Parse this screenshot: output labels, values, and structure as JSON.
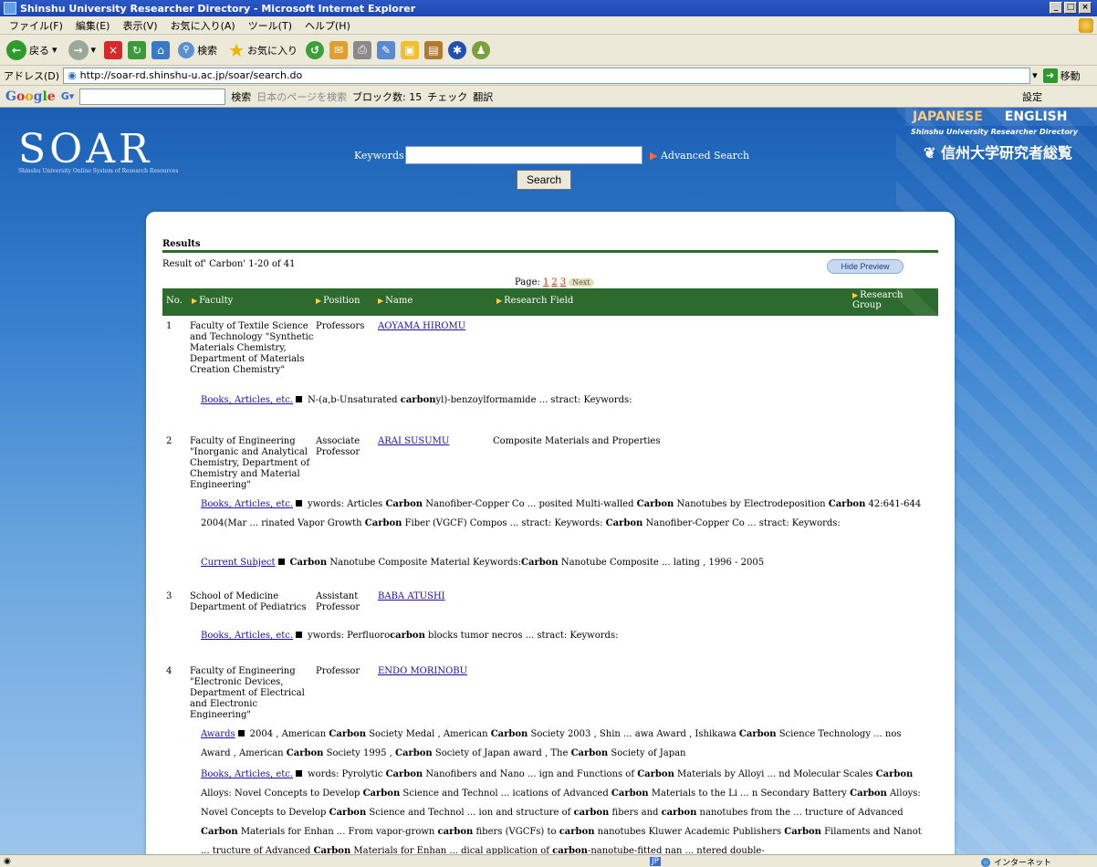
{
  "window": {
    "title": "Shinshu University Researcher Directory - Microsoft Internet Explorer",
    "controls": [
      "_",
      "□",
      "×"
    ]
  },
  "menu": [
    "ファイル(F)",
    "編集(E)",
    "表示(V)",
    "お気に入り(A)",
    "ツール(T)",
    "ヘルプ(H)"
  ],
  "toolbar": {
    "back": "戻る",
    "search": "検索",
    "favorites": "お気に入り"
  },
  "address": {
    "label": "アドレス(D)",
    "url": "http://soar-rd.shinshu-u.ac.jp/soar/search.do",
    "go": "移動"
  },
  "googlebar": {
    "logo": "Google",
    "search_btn": "検索",
    "page_search": "日本のページを検索",
    "blocked": "ブロック数: 15",
    "check": "チェック",
    "translate": "翻訳",
    "settings": "設定"
  },
  "site": {
    "logo": "SOAR",
    "logo_sub": "Shinshu University Online System of Research Resources",
    "keywords_label": "Keywords",
    "advanced": "Advanced Search",
    "search_btn": "Search",
    "lang_jp": "JAPANESE",
    "lang_en": "ENGLISH",
    "directory_en": "Shinshu University Researcher Directory",
    "directory_jp": "信州大学研究者総覧"
  },
  "results": {
    "heading": "Results",
    "summary": "Result of' Carbon'  1-20 of 41",
    "hide_preview": "Hide Preview",
    "page_label": "Page:",
    "pages": [
      "1",
      "2",
      "3"
    ],
    "next": "Next",
    "columns": [
      "No.",
      "Faculty",
      "Position",
      "Name",
      "Research Field",
      "Research Group"
    ]
  },
  "rows": [
    {
      "no": "1",
      "faculty": "Faculty of Textile Science and Technology \"Synthetic Materials Chemistry, Department of Materials Creation Chemistry\"",
      "position": "Professors",
      "name": "AOYAMA  HIROMU",
      "field": "",
      "snippets": [
        {
          "label": "Books, Articles, etc.",
          "text": "N-(a,b-Unsaturated carbonyl)-benzoylformamide ... stract:  Keywords:"
        }
      ]
    },
    {
      "no": "2",
      "faculty": "Faculty of Engineering \"Inorganic and Analytical Chemistry, Department of Chemistry and Material Engineering\"",
      "position": "Associate Professor",
      "name": "ARAI  SUSUMU",
      "field": "Composite Materials and Properties",
      "snippets": [
        {
          "label": "Books, Articles, etc.",
          "text": "ywords:      Articles   Carbon Nanofiber-Copper Co ... posited Multi-walled Carbon Nanotubes by Electrodeposition Carbon 42:641-644 2004(Mar ... rinated Vapor Growth Carbon Fiber (VGCF) Compos ... stract:  Keywords:        Carbon Nanofiber-Copper Co ... stract: Keywords:"
        },
        {
          "label": "Current Subject",
          "text": "Carbon Nanotube Composite Material     Keywords:Carbon Nanotube Composite ... lating , 1996 - 2005"
        }
      ]
    },
    {
      "no": "3",
      "faculty": "School of Medicine Department of Pediatrics",
      "position": "Assistant Professor",
      "name": "BABA  ATUSHI",
      "field": "",
      "snippets": [
        {
          "label": "Books, Articles, etc.",
          "text": "ywords:        Perfluorocarbon blocks tumor necros ... stract:  Keywords:"
        }
      ]
    },
    {
      "no": "4",
      "faculty": "Faculty of Engineering \"Electronic Devices, Department of Electrical and Electronic Engineering\"",
      "position": "Professor",
      "name": "ENDO  MORINOBU",
      "field": "",
      "snippets": [
        {
          "label": "Awards",
          "text": "2004 , American Carbon Society Medal , American Carbon Society   2003 , Shin ... awa Award , Ishikawa Carbon Science Technology ... nos Award , American Carbon Society   1995 , Carbon Society of Japan award , The Carbon Society of Japan"
        },
        {
          "label": "Books, Articles, etc.",
          "text": "words:        Pyrolytic Carbon Nanofibers and Nano ... ign and Functions of Carbon Materials by Alloyi ... nd Molecular Scales Carbon Alloys: Novel Concepts to Develop Carbon Science and Technol ... ications of Advanced Carbon Materials to the Li ... n Secondary Battery Carbon Alloys: Novel Concepts to Develop Carbon Science and Technol ... ion and structure   of carbon fibers and carbon nanotubes from the ... tructure of Advanced Carbon Materials for Enhan ...         From vapor-grown carbon fibers (VGCFs) to carbon nanotubes Kluwer Academic Publishers Carbon Filaments and Nanot ... tructure of Advanced Carbon Materials for Enhan ... dical application of carbon-nanotube-fitted nan ... ntered double-"
        }
      ]
    }
  ],
  "status": {
    "zone": "インターネット",
    "ime": "JP"
  }
}
